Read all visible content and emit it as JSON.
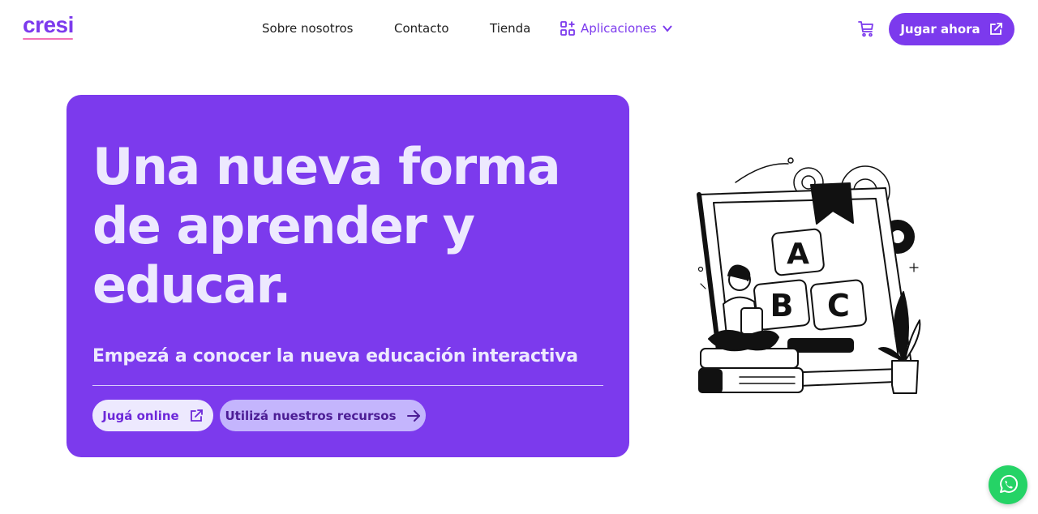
{
  "header": {
    "logo_text": "cresi",
    "nav": {
      "about": "Sobre nosotros",
      "contact": "Contacto",
      "store": "Tienda",
      "apps": "Aplicaciones"
    },
    "cta_label": "Jugar ahora"
  },
  "hero": {
    "title": "Una nueva forma de aprender y educar.",
    "subtitle": "Empezá a conocer la nueva educación interactiva",
    "btn_online": "Jugá online",
    "btn_resources": "Utilizá nuestros recursos"
  },
  "illustration": {
    "letters": [
      "A",
      "B",
      "C"
    ]
  },
  "icons": {
    "apps": "apps-grid-icon",
    "chevron": "chevron-down-icon",
    "cart": "cart-icon",
    "external": "external-link-icon",
    "arrow": "arrow-right-icon",
    "whatsapp": "whatsapp-icon"
  },
  "colors": {
    "brand": "#7c3aed",
    "hero_text": "#ede9fe",
    "whatsapp": "#25d366"
  }
}
